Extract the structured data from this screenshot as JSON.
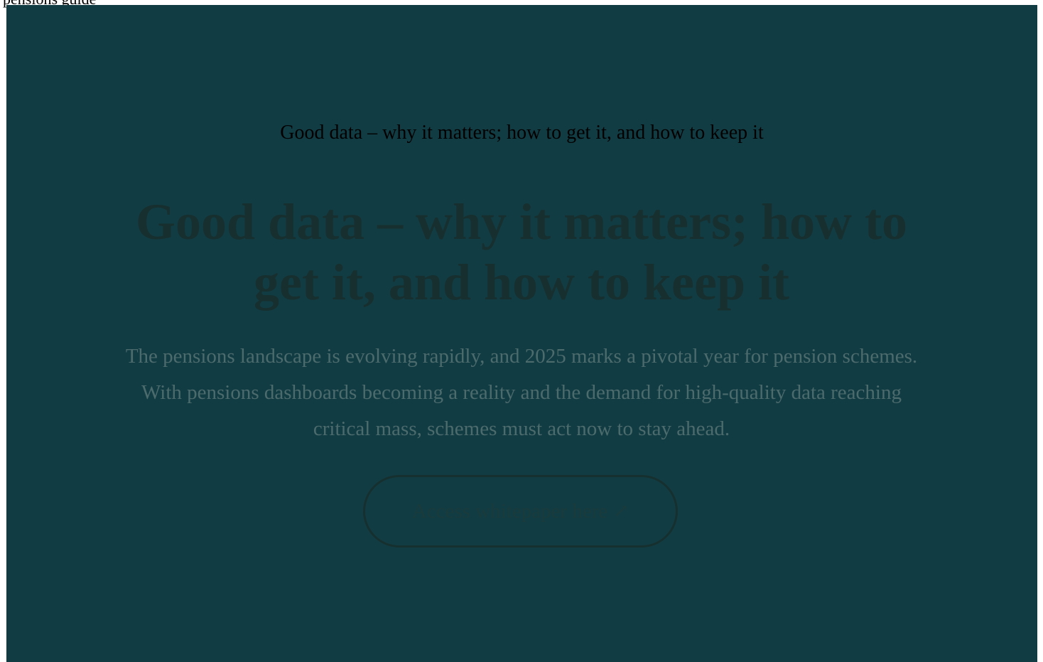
{
  "top_fragment": {
    "text": "pensions guide"
  },
  "hero": {
    "eyebrow": "Good data – why it matters; how to get it, and how to keep it",
    "title": "Good data – why it matters; how to get it, and how to keep it",
    "intro": "The pensions landscape is evolving rapidly, and 2025 marks a pivotal year for pension schemes. With pensions dashboards becoming a reality and the demand for high-quality data reaching critical mass, schemes must act now to stay ahead.",
    "cta": {
      "label": "Access whitepaper here",
      "icon": "arrow-up-right-icon",
      "glyph": "↗"
    }
  },
  "colors": {
    "hero_background": "#123c43",
    "title": "#172f2e",
    "intro": "#4c6b6d",
    "cta_border": "#16302f",
    "cta_text": "#1a3b3c"
  }
}
